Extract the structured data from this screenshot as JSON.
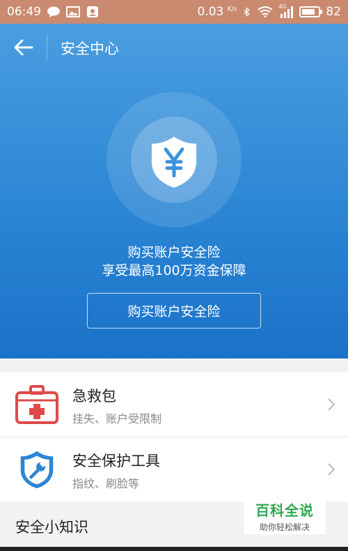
{
  "status_bar": {
    "time": "06:49",
    "speed_value": "0.03",
    "speed_unit": "K/s",
    "network": "4G",
    "battery": "82",
    "battery_level": 0.82,
    "left_icons": [
      "chat-bubble-icon",
      "image-icon",
      "notification-icon"
    ],
    "right_icons": [
      "bluetooth-icon",
      "wifi-icon",
      "signal-icon",
      "battery-icon"
    ]
  },
  "header": {
    "title": "安全中心"
  },
  "hero": {
    "line1": "购买账户安全险",
    "line2": "享受最高100万资金保障",
    "button_label": "购买账户安全险",
    "icon": "shield-yen-icon"
  },
  "list": {
    "items": [
      {
        "title": "急救包",
        "subtitle": "挂失、账户受限制",
        "icon": "first-aid-kit-icon"
      },
      {
        "title": "安全保护工具",
        "subtitle": "指纹、刷脸等",
        "icon": "shield-wrench-icon"
      }
    ]
  },
  "section": {
    "title": "安全小知识"
  },
  "watermark": {
    "main": "百科全说",
    "sub": "助你轻松解决"
  },
  "colors": {
    "hero_blue": "#2b86d4",
    "status_bar": "#c98a70",
    "first_aid_red": "#e04a4a",
    "tool_blue": "#2b86d4",
    "watermark_green": "#2fa84f"
  }
}
